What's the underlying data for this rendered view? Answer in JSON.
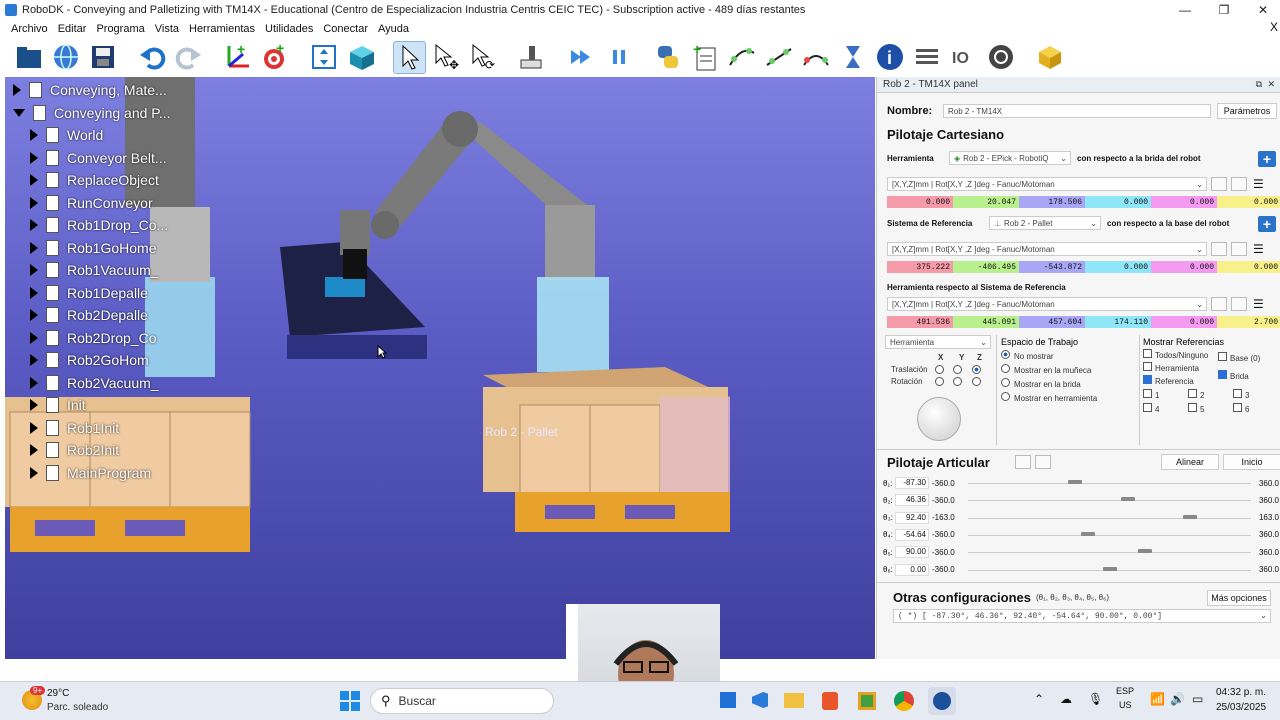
{
  "window": {
    "title": "RoboDK - Conveying and Palletizing with TM14X - Educational (Centro de Especializacion Industria Centris CEIC TEC) - Subscription active - 489 días restantes",
    "min": "—",
    "max": "❐",
    "close": "✕"
  },
  "menu": [
    "Archivo",
    "Editar",
    "Programa",
    "Vista",
    "Herramientas",
    "Utilidades",
    "Conectar",
    "Ayuda"
  ],
  "menu_close": "X",
  "tree": [
    {
      "label": "Conveying, Mate...",
      "expanded": false,
      "indent": 0
    },
    {
      "label": "Conveying and P...",
      "expanded": true,
      "indent": 0
    },
    {
      "label": "World",
      "indent": 1
    },
    {
      "label": "Conveyor Belt...",
      "indent": 1
    },
    {
      "label": "ReplaceObject",
      "indent": 1
    },
    {
      "label": "RunConveyor",
      "indent": 1
    },
    {
      "label": "Rob1Drop_Co...",
      "indent": 1
    },
    {
      "label": "Rob1GoHome",
      "indent": 1
    },
    {
      "label": "Rob1Vacuum_",
      "indent": 1
    },
    {
      "label": "Rob1Depalle",
      "indent": 1
    },
    {
      "label": "Rob2Depalle",
      "indent": 1
    },
    {
      "label": "Rob2Drop_Co",
      "indent": 1
    },
    {
      "label": "Rob2GoHom",
      "indent": 1
    },
    {
      "label": "Rob2Vacuum_",
      "indent": 1
    },
    {
      "label": "Init",
      "indent": 1
    },
    {
      "label": "Rob1Init",
      "indent": 1
    },
    {
      "label": "Rob2Init",
      "indent": 1
    },
    {
      "label": "MainProgram",
      "indent": 1
    }
  ],
  "viewport": {
    "pallet_label": "Rob 2 - Pallet"
  },
  "panel": {
    "title": "Rob 2 - TM14X panel",
    "name_label": "Nombre:",
    "name_value": "Rob 2 - TM14X",
    "params_btn": "Parámetros",
    "cartesian_title": "Pilotaje Cartesiano",
    "tool_label": "Herramienta",
    "tool_value": "Rob 2 - EPick - RobotiQ",
    "tool_ref": "con respecto a la brida del robot",
    "format": "[X,Y,Z]mm | Rot[X,Y ,Z ]deg - Fanuc/Motoman",
    "tool_vals": [
      "0.000",
      "20.047",
      "178.506",
      "0.000",
      "0.000",
      "0.000"
    ],
    "frame_label": "Sistema de Referencia",
    "frame_value": "Rob 2 - Pallet",
    "frame_ref": "con respecto a la base del robot",
    "frame_vals": [
      "375.222",
      "-406.495",
      "-543.872",
      "0.000",
      "0.000",
      "0.000"
    ],
    "tool_frame_label": "Herramienta respecto al Sistema de Referencia",
    "tf_vals": [
      "491.536",
      "445.091",
      "457.604",
      "174.110",
      "0.000",
      "2.700"
    ],
    "jog_dropdown": "Herramienta",
    "xyz": [
      "X",
      "Y",
      "Z"
    ],
    "traslacion": "Traslación",
    "rotacion": "Rotación",
    "workspace_title": "Espacio de Trabajo",
    "workspace_opts": [
      "No mostrar",
      "Mostrar en la muñeca",
      "Mostrar en la brida",
      "Mostrar en herramienta"
    ],
    "refs_title": "Mostrar Referencias",
    "refs_all": "Todos/Ninguno",
    "refs_base": "Base (0)",
    "refs_tool": "Herramienta",
    "refs_ref": "Referencia",
    "refs_flange": "Brida",
    "refs_nums": [
      "1",
      "2",
      "3",
      "4",
      "5",
      "6"
    ],
    "joint_title": "Pilotaje Articular",
    "align_btn": "Alinear",
    "home_btn": "Inicio",
    "joints": [
      {
        "label": "θ₁:",
        "value": "-87.30",
        "min": "-360.0",
        "max": "360.0",
        "pos": 0.378
      },
      {
        "label": "θ₂:",
        "value": "46.36",
        "min": "-360.0",
        "max": "360.0",
        "pos": 0.564
      },
      {
        "label": "θ₃:",
        "value": "92.40",
        "min": "-163.0",
        "max": "163.0",
        "pos": 0.783
      },
      {
        "label": "θ₄:",
        "value": "-54.64",
        "min": "-360.0",
        "max": "360.0",
        "pos": 0.424
      },
      {
        "label": "θ₅:",
        "value": "90.00",
        "min": "-360.0",
        "max": "360.0",
        "pos": 0.625
      },
      {
        "label": "θ₆:",
        "value": "0.00",
        "min": "-360.0",
        "max": "360.0",
        "pos": 0.5
      }
    ],
    "other_title": "Otras configuraciones",
    "other_sub": "(θ₁, θ₂, θ₃, θ₄, θ₅, θ₆)",
    "more_opts": "Más opciones",
    "config_value": "( *) [ -87.30°,  46.36°,  92.40°,  -54.64°,  90.00°,  0.00°]"
  },
  "taskbar": {
    "weather_temp": "29°C",
    "weather_desc": "Parc. soleado",
    "weather_badge": "9+",
    "search": "Buscar",
    "lang1": "ESP",
    "lang2": "US",
    "time": "04:32 p. m.",
    "date": "25/03/2025"
  },
  "colors": {
    "x": "#f59aa8",
    "y": "#b7f08c",
    "z": "#a9a6f5",
    "rx": "#8fe6f7",
    "ry": "#f59af1",
    "rz": "#f8f08a",
    "accent": "#2a73c9"
  }
}
